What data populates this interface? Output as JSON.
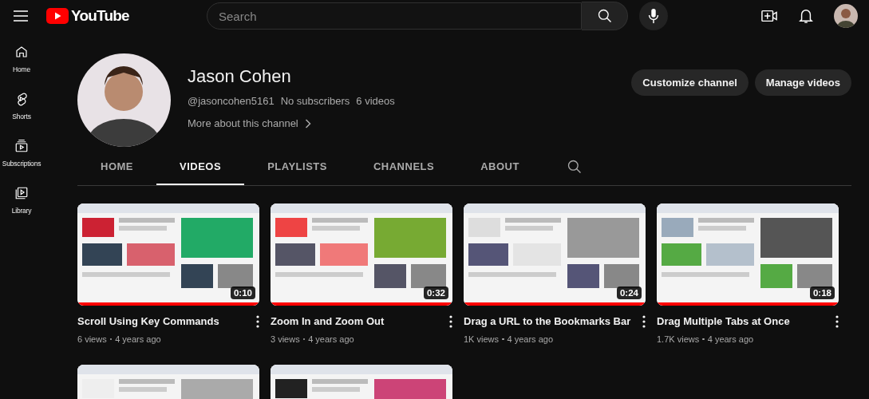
{
  "topbar": {
    "logo": "YouTube",
    "search": {
      "placeholder": "Search"
    }
  },
  "sidebar": {
    "items": [
      {
        "label": "Home",
        "kind": "home"
      },
      {
        "label": "Shorts",
        "kind": "shorts"
      },
      {
        "label": "Subscriptions",
        "kind": "subscriptions"
      },
      {
        "label": "Library",
        "kind": "library"
      }
    ]
  },
  "channel": {
    "name": "Jason Cohen",
    "handle": "@jasoncohen5161",
    "subscribers": "No subscribers",
    "videos_count": "6 videos",
    "about_link": "More about this channel",
    "buttons": [
      "Customize channel",
      "Manage videos"
    ]
  },
  "tabs": [
    {
      "label": "HOME",
      "selected": false
    },
    {
      "label": "VIDEOS",
      "selected": true
    },
    {
      "label": "PLAYLISTS",
      "selected": false
    },
    {
      "label": "CHANNELS",
      "selected": false
    },
    {
      "label": "ABOUT",
      "selected": false
    }
  ],
  "videos": [
    {
      "kind": "video",
      "title": "Scroll Using Key Commands",
      "duration": "0:10",
      "views": "6 views",
      "age": "4 years ago",
      "level": 1
    },
    {
      "kind": "video",
      "title": "Zoom In and Zoom Out",
      "duration": "0:32",
      "views": "3 views",
      "age": "4 years ago",
      "level": 1
    },
    {
      "kind": "video",
      "title": "Drag a URL to the Bookmarks Bar",
      "duration": "0:24",
      "views": "1K views",
      "age": "4 years ago",
      "level": 1
    },
    {
      "kind": "video",
      "title": "Drag Multiple Tabs at Once",
      "duration": "0:18",
      "views": "1.7K views",
      "age": "4 years ago",
      "level": 1
    },
    {
      "kind": "picture"
    },
    {
      "kind": "picture"
    }
  ]
}
